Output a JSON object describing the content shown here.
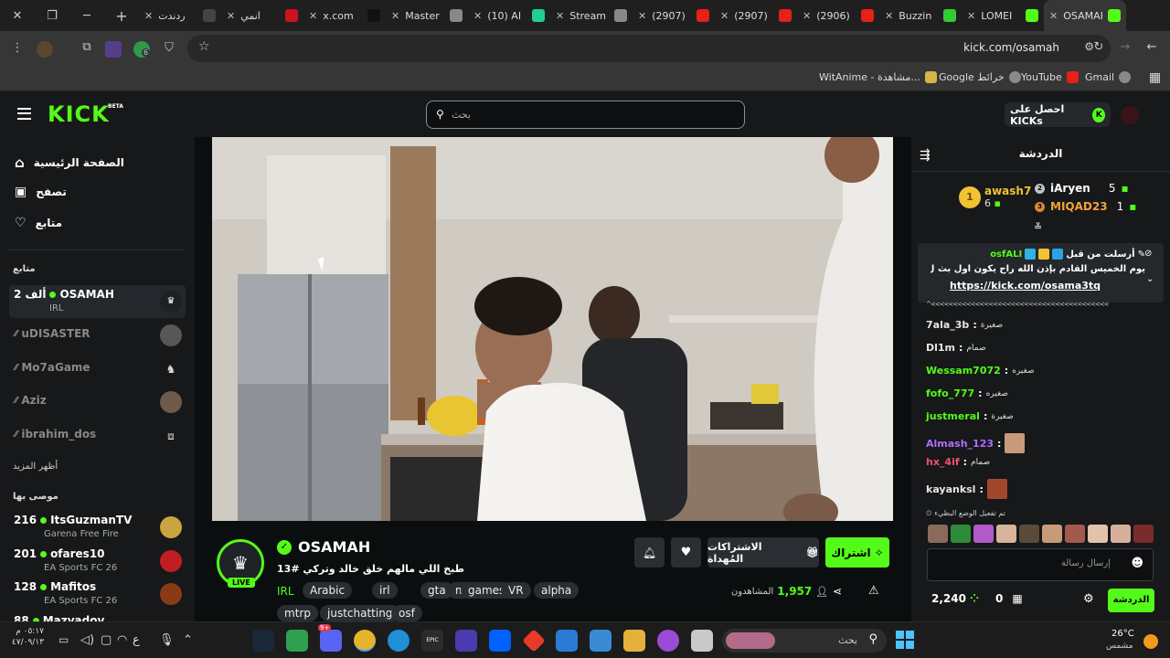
{
  "browser": {
    "tabs": [
      {
        "label": "ردندت",
        "icon": "reddit-icon"
      },
      {
        "label": "انمي",
        "icon": "anime-site-icon"
      },
      {
        "label": "x.com",
        "icon": "x-icon"
      },
      {
        "label": "Master",
        "icon": "globe-icon"
      },
      {
        "label": "(10) AI",
        "icon": "ai-icon"
      },
      {
        "label": "Stream",
        "icon": "globe-icon"
      },
      {
        "label": "(2907)",
        "icon": "youtube-icon"
      },
      {
        "label": "(2907)",
        "icon": "youtube-icon"
      },
      {
        "label": "(2906)",
        "icon": "youtube-icon"
      },
      {
        "label": "Buzzin",
        "icon": "buzzin-icon"
      },
      {
        "label": "LOMEI",
        "icon": "kick-icon"
      },
      {
        "label": "OSAMAH",
        "icon": "kick-icon",
        "active": true
      }
    ],
    "url": "kick.com/osamah",
    "extension_badge": "6",
    "bookmarks": [
      {
        "label": "Gmail",
        "icon": "gmail-icon"
      },
      {
        "label": "YouTube",
        "icon": "youtube-icon"
      },
      {
        "label": "Google خرائط",
        "icon": "maps-icon"
      },
      {
        "label": "WitAnime - مشاهدة...",
        "icon": "witanime-icon"
      }
    ]
  },
  "header": {
    "logo": "KICK",
    "beta": "BETA",
    "search_placeholder": "بحث",
    "kicks_button": "احصل على KICKs"
  },
  "sidebar": {
    "nav": [
      {
        "label": "الصفحة الرئيسية",
        "icon": "home-icon"
      },
      {
        "label": "تصفح",
        "icon": "browse-icon"
      },
      {
        "label": "متابع",
        "icon": "heart-icon"
      }
    ],
    "following_title": "متابع",
    "following": [
      {
        "name": "OSAMAH",
        "viewers": "2 ألف",
        "category": "IRL",
        "live": true
      },
      {
        "name": "uDISASTER",
        "live": false
      },
      {
        "name": "Mo7aGame",
        "live": false
      },
      {
        "name": "Aziz",
        "live": false
      },
      {
        "name": "ibrahim_dos",
        "live": false
      }
    ],
    "show_more": "أظهر المزيد",
    "recommended_title": "موصى بها",
    "recommended": [
      {
        "name": "ItsGuzmanTV",
        "viewers": "216",
        "category": "Garena Free Fire"
      },
      {
        "name": "ofares10",
        "viewers": "201",
        "category": "EA Sports FC 26"
      },
      {
        "name": "Mafitos",
        "viewers": "128",
        "category": "EA Sports FC 26"
      },
      {
        "name": "Mazyadov",
        "viewers": "88",
        "category": ""
      }
    ]
  },
  "stream": {
    "channel": "OSAMAH",
    "live_badge": "LIVE",
    "title": "طبخ اللي مالهم خلق خالد وتركي #13",
    "category": "IRL",
    "tags": [
      "Arabic",
      "irl",
      "gta",
      "mt",
      "games",
      "VR",
      "alpha",
      "mtrp",
      "justchatting",
      "osf"
    ],
    "viewers": "1,957",
    "viewers_label": "المشاهدون",
    "subscribe": "اشتراك",
    "gift_subs": "الاشتراكات المُهداة"
  },
  "chat": {
    "title": "الدردشة",
    "leaders": [
      {
        "rank": "1",
        "name": "awash7",
        "count": "6"
      },
      {
        "rank": "2",
        "name": "iAryen",
        "count": "5"
      },
      {
        "rank": "3",
        "name": "MIQAD23",
        "count": "1"
      }
    ],
    "pinned": {
      "sender": "osfALI",
      "label": "أرسلت من قبل",
      "text": "يوم الخميس القادم بإذن الله راح يكون اول بث ل اسامة العتقي",
      "link": "https://kick.com/osama3tq"
    },
    "cut_line": "^<<<<<<<<<<<<<<<<<<<<<<<<<<<<<<<<<<<<<<<<<",
    "messages": [
      {
        "user": "7ala_3b",
        "text": "صغيرة",
        "color": "#e6e6e6"
      },
      {
        "user": "Dl1m",
        "text": "صمام",
        "color": "#e6e6e6"
      },
      {
        "user": "Wessam7072",
        "text": "صغيره",
        "color": "#53fc18"
      },
      {
        "user": "fofo_777",
        "text": "صغيره",
        "color": "#53fc18"
      },
      {
        "user": "justmeral",
        "text": "صغيرة",
        "color": "#53fc18"
      },
      {
        "user": "Almash_123",
        "text": "",
        "color": "#b36bff",
        "emote": true
      },
      {
        "user": "hx_4if",
        "text": "صمام",
        "color": "#ff4d6d"
      },
      {
        "user": "kayanksl",
        "text": "",
        "color": "#e6e6e6",
        "emote": true
      }
    ],
    "slow_mode": "تم تفعيل الوضع البطيء",
    "input_placeholder": "إرسال رسالة",
    "points": "2,240",
    "kicks": "0",
    "send_button": "الدردشة"
  },
  "taskbar": {
    "search_placeholder": "بحث",
    "weather_temp": "26°C",
    "weather_label": "مشمس",
    "time": "٠٥:١٧ م",
    "date": "٤٧/٠٩/١٣",
    "language": "ع",
    "discord_badge": "9+"
  },
  "colors": {
    "accent": "#53fc18",
    "bg": "#0b0e0f",
    "panel": "#16181a"
  }
}
